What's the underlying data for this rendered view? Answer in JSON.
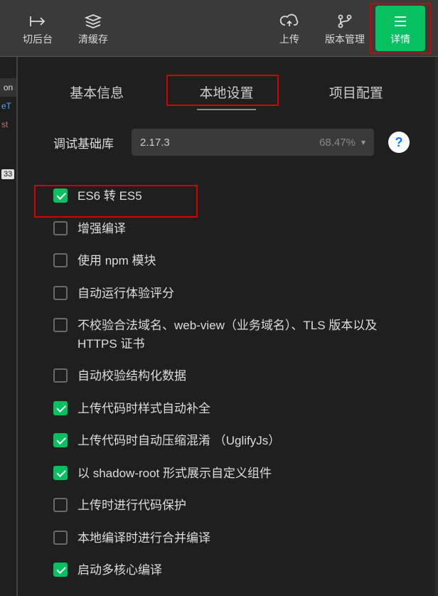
{
  "left_strip": {
    "on": "on",
    "t1": "eT",
    "t2": "st",
    "badge": "33"
  },
  "toolbar": {
    "switch_back": "切后台",
    "clear_cache": "清缓存",
    "upload": "上传",
    "version_mgmt": "版本管理",
    "details": "详情"
  },
  "tabs": {
    "basic": "基本信息",
    "local": "本地设置",
    "project": "项目配置"
  },
  "lib": {
    "label": "调试基础库",
    "version": "2.17.3",
    "pct": "68.47%"
  },
  "checks": [
    {
      "key": "es6",
      "label": "ES6 转 ES5",
      "checked": true
    },
    {
      "key": "enhanced",
      "label": "增强编译",
      "checked": false
    },
    {
      "key": "npm",
      "label": "使用 npm 模块",
      "checked": false
    },
    {
      "key": "auto-eval",
      "label": "自动运行体验评分",
      "checked": false
    },
    {
      "key": "no-check-domain",
      "label": "不校验合法域名、web-view（业务域名）、TLS 版本以及 HTTPS 证书",
      "checked": false
    },
    {
      "key": "auto-struct",
      "label": "自动校验结构化数据",
      "checked": false
    },
    {
      "key": "auto-style",
      "label": "上传代码时样式自动补全",
      "checked": true
    },
    {
      "key": "uglify",
      "label": "上传代码时自动压缩混淆 （UglifyJs）",
      "checked": true
    },
    {
      "key": "shadow-root",
      "label": "以 shadow-root 形式展示自定义组件",
      "checked": true
    },
    {
      "key": "protect",
      "label": "上传时进行代码保护",
      "checked": false
    },
    {
      "key": "merge",
      "label": "本地编译时进行合并编译",
      "checked": false
    },
    {
      "key": "multicore",
      "label": "启动多核心编译",
      "checked": true
    }
  ]
}
